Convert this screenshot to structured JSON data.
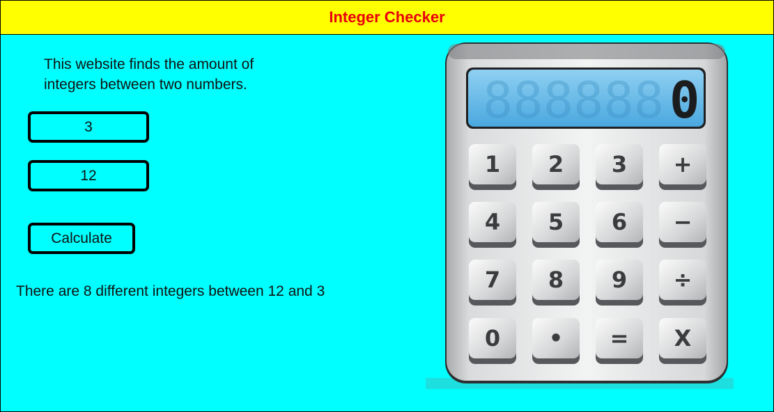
{
  "header": {
    "title": "Integer Checker"
  },
  "main": {
    "description": "This website finds the amount of integers between two numbers.",
    "first_number": "3",
    "second_number": "12",
    "calculate_label": "Calculate",
    "result": "There are 8 different integers between 12 and 3"
  },
  "calculator_image": {
    "display_value": "0",
    "display_ghost": "888888",
    "keys": [
      "1",
      "2",
      "3",
      "+",
      "4",
      "5",
      "6",
      "−",
      "7",
      "8",
      "9",
      "÷",
      "0",
      "•",
      "=",
      "X"
    ]
  },
  "colors": {
    "page_background": "#00ffff",
    "header_background": "#ffff00",
    "title_color": "#e8000b"
  }
}
